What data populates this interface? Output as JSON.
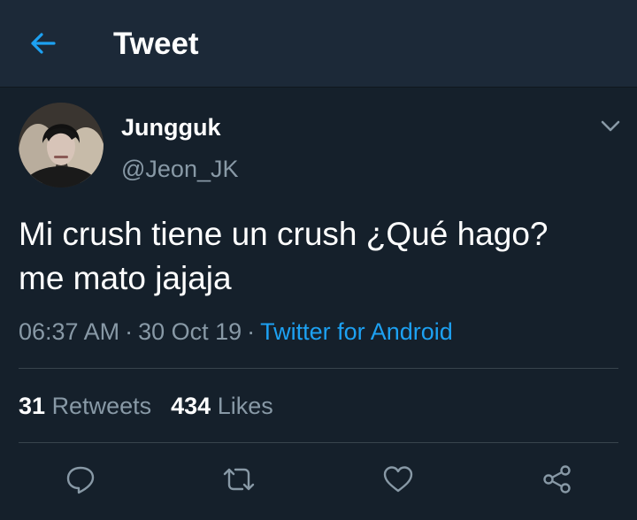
{
  "header": {
    "back_icon": "arrow-left-icon",
    "title": "Tweet"
  },
  "tweet": {
    "author": {
      "display_name": "Jungguk",
      "handle": "@Jeon_JK"
    },
    "text_lines": [
      "Mi crush tiene un crush ¿Qué hago?",
      "me mato jajaja"
    ],
    "time": "06:37 AM",
    "date": "30 Oct 19",
    "separator": "·",
    "source": "Twitter for Android",
    "stats": {
      "retweets_count": "31",
      "retweets_label": "Retweets",
      "likes_count": "434",
      "likes_label": "Likes"
    },
    "actions": [
      "reply-icon",
      "retweet-icon",
      "like-icon",
      "share-icon"
    ]
  },
  "colors": {
    "background": "#15202b",
    "header_background": "#1c2938",
    "accent": "#1da1f2",
    "secondary_text": "#8899a6",
    "divider": "#38444d"
  }
}
